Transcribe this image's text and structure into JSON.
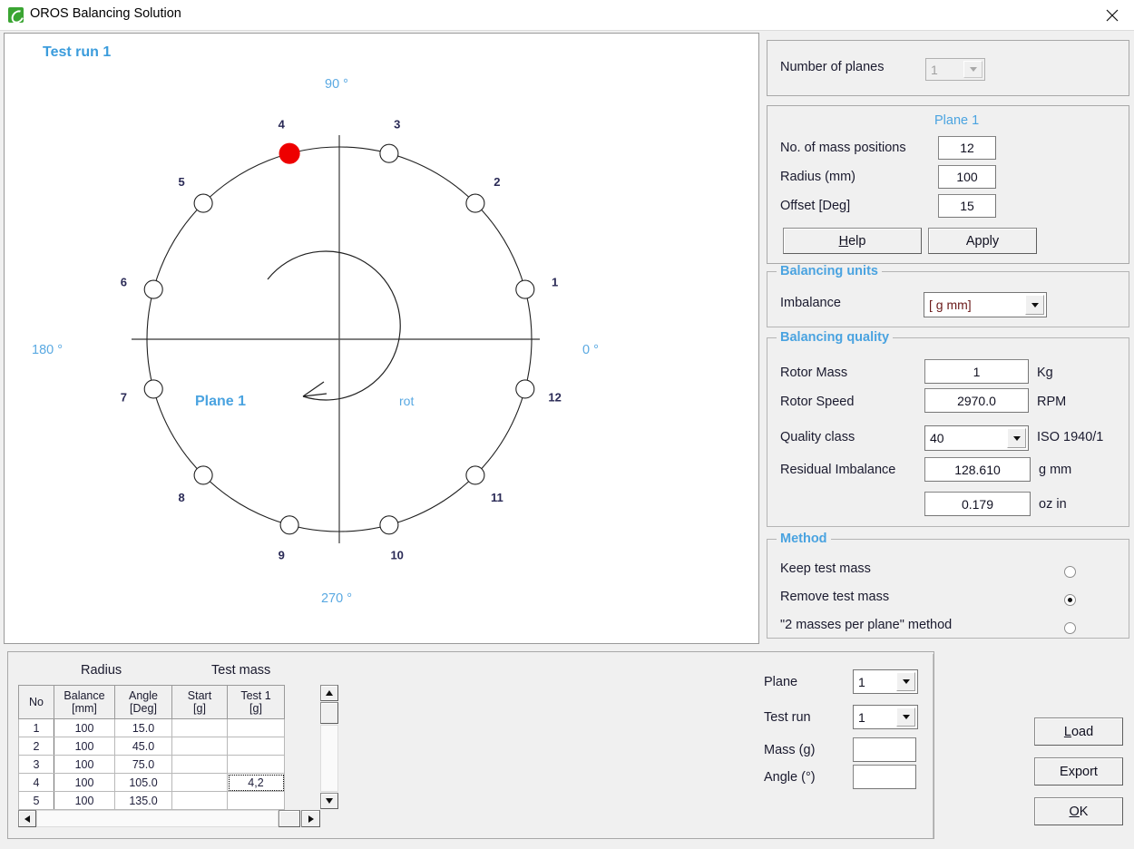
{
  "window": {
    "title": "OROS Balancing Solution",
    "app_icon": "oros-leaf-icon",
    "close_icon": "close-icon"
  },
  "chart_data": {
    "type": "scatter",
    "title": "Test run 1",
    "plane_label": "Plane 1",
    "rotation_label": "rot",
    "rotation_direction": "clockwise",
    "axis_labels": {
      "right": "0 °",
      "top": "90 °",
      "left": "180 °",
      "bottom": "270 °"
    },
    "radius_mm": 100,
    "offset_deg": 15,
    "num_positions": 12,
    "highlight_color": "#ee0000",
    "marker_color": "#ffffff",
    "points": [
      {
        "no": 1,
        "angle_deg": 15.0,
        "label": "1",
        "highlighted": false
      },
      {
        "no": 2,
        "angle_deg": 45.0,
        "label": "2",
        "highlighted": false
      },
      {
        "no": 3,
        "angle_deg": 75.0,
        "label": "3",
        "highlighted": false
      },
      {
        "no": 4,
        "angle_deg": 105.0,
        "label": "4",
        "highlighted": true
      },
      {
        "no": 5,
        "angle_deg": 135.0,
        "label": "5",
        "highlighted": false
      },
      {
        "no": 6,
        "angle_deg": 165.0,
        "label": "6",
        "highlighted": false
      },
      {
        "no": 7,
        "angle_deg": 195.0,
        "label": "7",
        "highlighted": false
      },
      {
        "no": 8,
        "angle_deg": 225.0,
        "label": "8",
        "highlighted": false
      },
      {
        "no": 9,
        "angle_deg": 255.0,
        "label": "9",
        "highlighted": false
      },
      {
        "no": 10,
        "angle_deg": 285.0,
        "label": "10",
        "highlighted": false
      },
      {
        "no": 11,
        "angle_deg": 315.0,
        "label": "11",
        "highlighted": false
      },
      {
        "no": 12,
        "angle_deg": 345.0,
        "label": "12",
        "highlighted": false
      }
    ]
  },
  "planes_panel": {
    "label": "Number of planes",
    "value": "1",
    "disabled": true
  },
  "plane_settings": {
    "heading": "Plane 1",
    "mass_positions_label": "No. of mass positions",
    "mass_positions_value": "12",
    "radius_label": "Radius (mm)",
    "radius_value": "100",
    "offset_label": "Offset   [Deg]",
    "offset_value": "15",
    "help_button": "Help",
    "help_accel": "H",
    "apply_button": "Apply"
  },
  "balancing_units": {
    "title": "Balancing units",
    "imbalance_label": "Imbalance",
    "imbalance_value": "[ g mm]"
  },
  "balancing_quality": {
    "title": "Balancing quality",
    "rotor_mass_label": "Rotor Mass",
    "rotor_mass_value": "1",
    "rotor_mass_unit": "Kg",
    "rotor_speed_label": "Rotor Speed",
    "rotor_speed_value": "2970.0",
    "rotor_speed_unit": "RPM",
    "quality_class_label": "Quality class",
    "quality_class_value": "40",
    "quality_class_unit": "ISO 1940/1",
    "residual_label": "Residual Imbalance",
    "residual_value": "128.610",
    "residual_unit": "g mm",
    "residual_alt_value": "0.179",
    "residual_alt_unit": "oz in"
  },
  "method": {
    "title": "Method",
    "options": [
      {
        "label": "Keep test mass",
        "selected": false
      },
      {
        "label": "Remove test mass",
        "selected": true
      },
      {
        "label": "\"2 masses per plane\" method",
        "selected": false
      }
    ]
  },
  "grid": {
    "group_headers": [
      {
        "label": "Radius"
      },
      {
        "label": "Test mass"
      }
    ],
    "columns": [
      "No",
      "Balance\n[mm]",
      "Angle\n[Deg]",
      "Start\n[g]",
      "Test 1\n[g]"
    ],
    "columns_flat": [
      {
        "line1": "No",
        "line2": ""
      },
      {
        "line1": "Balance",
        "line2": "[mm]"
      },
      {
        "line1": "Angle",
        "line2": "[Deg]"
      },
      {
        "line1": "Start",
        "line2": "[g]"
      },
      {
        "line1": "Test 1",
        "line2": "[g]"
      }
    ],
    "rows": [
      {
        "no": "1",
        "balance": "100",
        "angle": "15.0",
        "start": "",
        "test1": "",
        "focused": false
      },
      {
        "no": "2",
        "balance": "100",
        "angle": "45.0",
        "start": "",
        "test1": "",
        "focused": false
      },
      {
        "no": "3",
        "balance": "100",
        "angle": "75.0",
        "start": "",
        "test1": "",
        "focused": false
      },
      {
        "no": "4",
        "balance": "100",
        "angle": "105.0",
        "start": "",
        "test1": "4,2",
        "focused": true
      },
      {
        "no": "5",
        "balance": "100",
        "angle": "135.0",
        "start": "",
        "test1": "",
        "focused": false
      }
    ]
  },
  "entry_controls": {
    "plane_label": "Plane",
    "plane_value": "1",
    "test_run_label": "Test run",
    "test_run_value": "1",
    "mass_label": "Mass (g)",
    "mass_value": "",
    "angle_label": "Angle (°)",
    "angle_value": ""
  },
  "action_buttons": [
    {
      "label": "Load",
      "accel": "L",
      "name": "load-button"
    },
    {
      "label": "Export",
      "accel": "",
      "name": "export-button"
    },
    {
      "label": "OK",
      "accel": "O",
      "name": "ok-button"
    }
  ]
}
